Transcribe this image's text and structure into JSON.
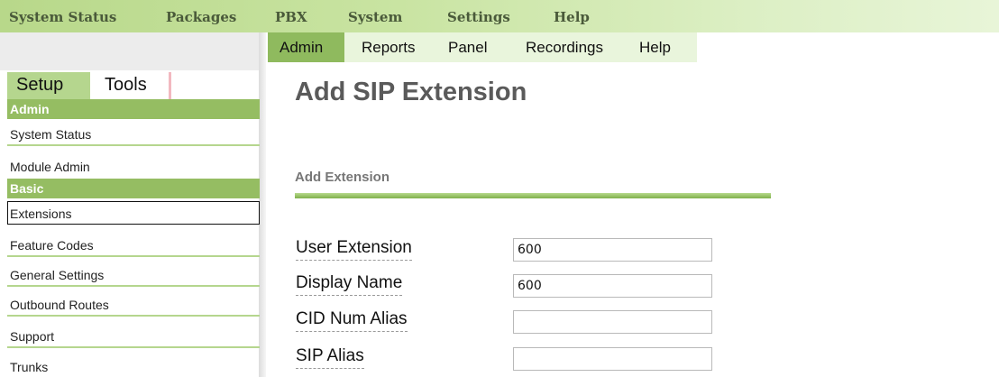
{
  "top_menu": [
    "System Status",
    "Packages",
    "PBX",
    "System",
    "Settings",
    "Help"
  ],
  "sub_nav": [
    "Admin",
    "Reports",
    "Panel",
    "Recordings",
    "Help"
  ],
  "sub_nav_active": "Admin",
  "side_tabs": [
    "Setup",
    "Tools"
  ],
  "side_menu": {
    "section_admin": "Admin",
    "admin_items": [
      "System Status",
      "Module Admin"
    ],
    "section_basic": "Basic",
    "basic_items": [
      "Extensions",
      "Feature Codes",
      "General Settings",
      "Outbound Routes",
      "Support",
      "Trunks"
    ],
    "selected": "Extensions"
  },
  "main": {
    "title": "Add SIP Extension",
    "section": "Add Extension",
    "fields": [
      {
        "label": "User Extension",
        "value": "600"
      },
      {
        "label": "Display Name",
        "value": "600"
      },
      {
        "label": "CID Num Alias",
        "value": ""
      },
      {
        "label": "SIP Alias",
        "value": ""
      }
    ]
  },
  "colors": {
    "menu_green": "#95bd62",
    "accent_green": "#8fba5e",
    "title_grey": "#5a5a5a"
  }
}
